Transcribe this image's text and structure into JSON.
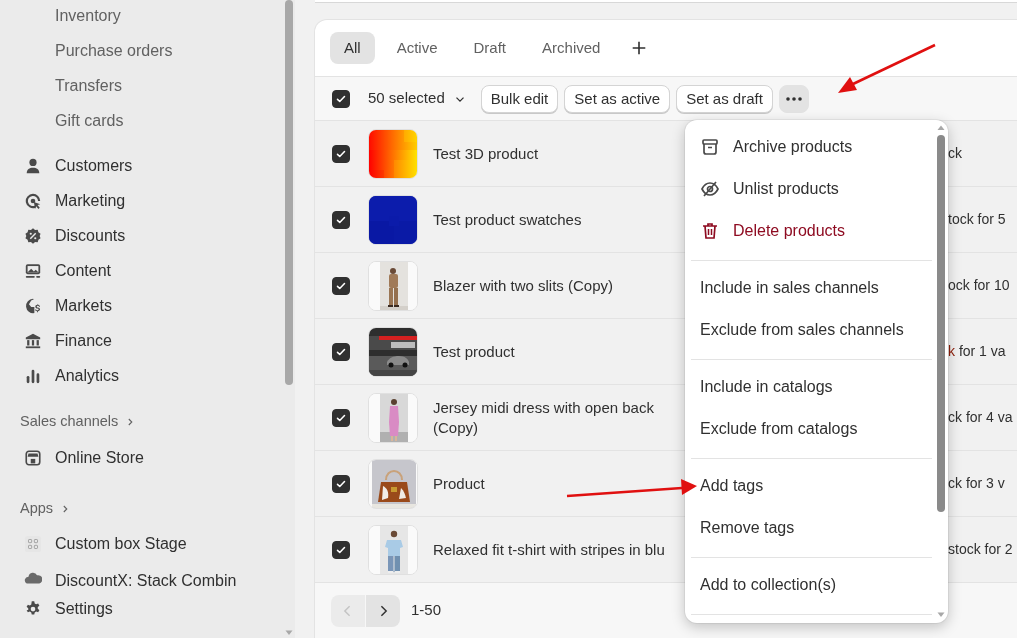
{
  "sidebar": {
    "sub_items": [
      "Inventory",
      "Purchase orders",
      "Transfers",
      "Gift cards"
    ],
    "items": [
      "Customers",
      "Marketing",
      "Discounts",
      "Content",
      "Markets",
      "Finance",
      "Analytics"
    ],
    "sales_channels": {
      "heading": "Sales channels",
      "items": [
        "Online Store"
      ]
    },
    "apps": {
      "heading": "Apps",
      "items": [
        "Custom box Stage",
        "DiscountX: Stack Combin"
      ]
    },
    "settings": "Settings"
  },
  "tabs": [
    {
      "label": "All",
      "selected": true
    },
    {
      "label": "Active",
      "selected": false
    },
    {
      "label": "Draft",
      "selected": false
    },
    {
      "label": "Archived",
      "selected": false
    }
  ],
  "bulk_actions": {
    "checked": true,
    "count": "50 selected",
    "buttons": [
      "Bulk edit",
      "Set as active",
      "Set as draft"
    ],
    "more_expanded": true
  },
  "rows": [
    {
      "checked": true,
      "name": "Test 3D product",
      "inventory": [
        {
          "text": "ck",
          "alert": false
        }
      ]
    },
    {
      "checked": true,
      "name": "Test product swatches",
      "inventory": [
        {
          "text": "tock for 5",
          "alert": false
        }
      ]
    },
    {
      "checked": true,
      "name": "Blazer with two slits (Copy)",
      "inventory": [
        {
          "text": "ock for 10",
          "alert": false
        }
      ]
    },
    {
      "checked": true,
      "name": "Test product",
      "inventory": [
        {
          "text": "k",
          "alert": true
        },
        {
          "text": " for 1 va",
          "alert": false
        }
      ]
    },
    {
      "checked": true,
      "name": "Jersey midi dress with open back\n(Copy)",
      "inventory": [
        {
          "text": "ck for 4 va",
          "alert": false
        }
      ]
    },
    {
      "checked": true,
      "name": "Product",
      "inventory": [
        {
          "text": "ck for 3 v",
          "alert": false
        }
      ]
    },
    {
      "checked": true,
      "name": "Relaxed fit t-shirt with stripes in blu",
      "inventory": [
        {
          "text": "stock for 2",
          "alert": false
        }
      ]
    }
  ],
  "pagination": {
    "previous_disabled": true,
    "next_disabled": false,
    "range": "1-50"
  },
  "menu": {
    "groups": [
      [
        {
          "label": "Archive products",
          "destructive": false
        },
        {
          "label": "Unlist products",
          "destructive": false
        },
        {
          "label": "Delete products",
          "destructive": true
        }
      ],
      [
        {
          "label": "Include in sales channels",
          "destructive": false
        },
        {
          "label": "Exclude from sales channels",
          "destructive": false
        }
      ],
      [
        {
          "label": "Include in catalogs",
          "destructive": false
        },
        {
          "label": "Exclude from catalogs",
          "destructive": false
        }
      ],
      [
        {
          "label": "Add tags",
          "destructive": false
        },
        {
          "label": "Remove tags",
          "destructive": false
        }
      ],
      [
        {
          "label": "Add to collection(s)",
          "destructive": false
        }
      ]
    ]
  }
}
